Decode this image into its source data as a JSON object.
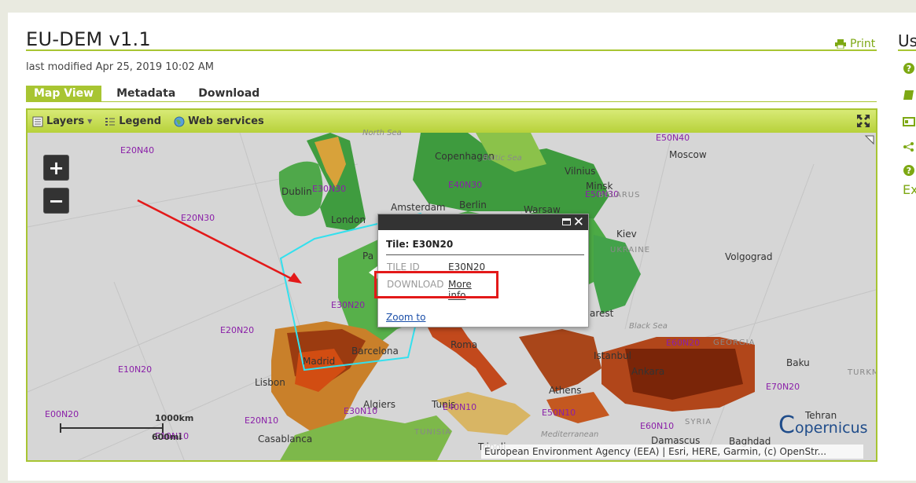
{
  "page": {
    "title": "EU-DEM v1.1",
    "print_label": "Print",
    "last_modified": "last modified Apr 25, 2019 10:02 AM"
  },
  "tabs": [
    {
      "label": "Map View",
      "active": true
    },
    {
      "label": "Metadata",
      "active": false
    },
    {
      "label": "Download",
      "active": false
    }
  ],
  "toolbar": {
    "layers_label": "Layers",
    "legend_label": "Legend",
    "web_services_label": "Web services"
  },
  "map": {
    "zoom_in": "+",
    "zoom_out": "−",
    "cities": [
      "Copenhagen",
      "Moscow",
      "Vilnius",
      "Minsk",
      "Dublin",
      "Amsterdam",
      "Berlin",
      "Warsaw",
      "London",
      "Kiev",
      "Volgograd",
      "Pa",
      "Barcelona",
      "Roma",
      "Madrid",
      "Istanbul",
      "Ankara",
      "Baku",
      "Lisbon",
      "Algiers",
      "Tunis",
      "Athens",
      "Tehran",
      "Casablanca",
      "Damascus",
      "Baghdad",
      "Tripoli",
      "arest"
    ],
    "tiles": [
      "E20N40",
      "E50N40",
      "E30N30",
      "E40N30",
      "E50N30",
      "E20N30",
      "E30N20",
      "E20N20",
      "E60N20",
      "E10N20",
      "E70N20",
      "E00N20",
      "E20N10",
      "E30N10",
      "E40N10",
      "E50N10",
      "E60N10",
      "E10N10"
    ],
    "seas": [
      "North Sea",
      "Baltic Sea",
      "Black Sea",
      "Mediterranean"
    ],
    "countries": [
      "BELARUS",
      "UKRAINE",
      "GEORGIA",
      "TURKM",
      "TUNISIA",
      "SYRIA"
    ],
    "scale_km": "1000km",
    "scale_mi": "600mi",
    "attribution": "European Environment Agency (EEA) | Esri, HERE, Garmin, (c) OpenStr...",
    "logo_text": "opernicus"
  },
  "popup": {
    "title": "Tile: E30N20",
    "tile_id_label": "TILE ID",
    "tile_id_value": "E30N20",
    "download_label": "DOWNLOAD",
    "download_link": "More info",
    "zoom_to": "Zoom to"
  },
  "sidebar": {
    "title": "Us",
    "extra": "Ex"
  },
  "colors": {
    "accent": "#a8c532",
    "link": "#7da813",
    "tile_label": "#8a1fa8",
    "highlight": "#e31919",
    "tile_outline": "#33e0ee"
  }
}
